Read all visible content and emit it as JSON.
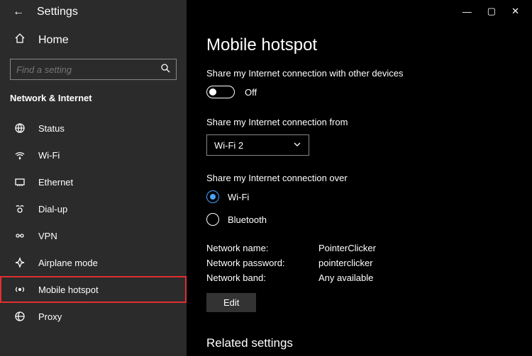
{
  "app_title": "Settings",
  "home_label": "Home",
  "search_placeholder": "Find a setting",
  "section_title": "Network & Internet",
  "nav": [
    {
      "label": "Status"
    },
    {
      "label": "Wi-Fi"
    },
    {
      "label": "Ethernet"
    },
    {
      "label": "Dial-up"
    },
    {
      "label": "VPN"
    },
    {
      "label": "Airplane mode"
    },
    {
      "label": "Mobile hotspot"
    },
    {
      "label": "Proxy"
    }
  ],
  "page_title": "Mobile hotspot",
  "share_toggle_label": "Share my Internet connection with other devices",
  "toggle_state": "Off",
  "share_from_label": "Share my Internet connection from",
  "share_from_value": "Wi-Fi 2",
  "share_over_label": "Share my Internet connection over",
  "radio_wifi": "Wi-Fi",
  "radio_bluetooth": "Bluetooth",
  "info": {
    "name_label": "Network name:",
    "name_value": "PointerClicker",
    "pass_label": "Network password:",
    "pass_value": "pointerclicker",
    "band_label": "Network band:",
    "band_value": "Any available"
  },
  "edit_label": "Edit",
  "related_title": "Related settings"
}
